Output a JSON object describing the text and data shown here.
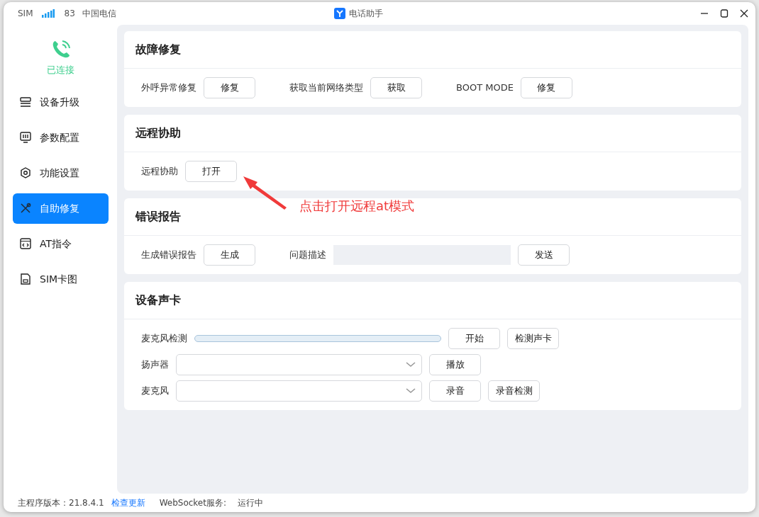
{
  "title_bar": {
    "sim_label": "SIM",
    "signal_value": "83",
    "carrier": "中国电信",
    "app_title": "电话助手"
  },
  "sidebar": {
    "status": "已连接",
    "items": [
      {
        "label": "设备升级",
        "selected": false
      },
      {
        "label": "参数配置",
        "selected": false
      },
      {
        "label": "功能设置",
        "selected": false
      },
      {
        "label": "自助修复",
        "selected": true
      },
      {
        "label": "AT指令",
        "selected": false
      },
      {
        "label": "SIM卡图",
        "selected": false
      }
    ]
  },
  "sections": [
    {
      "title": "故障修复",
      "rows": [
        [
          {
            "kind": "label",
            "text": "外呼异常修复"
          },
          {
            "kind": "button",
            "text": "修复"
          },
          {
            "kind": "label",
            "text": "获取当前网络类型"
          },
          {
            "kind": "button",
            "text": "获取"
          },
          {
            "kind": "label",
            "text": "BOOT MODE"
          },
          {
            "kind": "button",
            "text": "修复"
          }
        ]
      ]
    },
    {
      "title": "远程协助",
      "rows": [
        [
          {
            "kind": "label",
            "text": "远程协助"
          },
          {
            "kind": "button",
            "text": "打开"
          }
        ]
      ]
    },
    {
      "title": "错误报告",
      "rows": [
        [
          {
            "kind": "label",
            "text": "生成错误报告"
          },
          {
            "kind": "button",
            "text": "生成"
          },
          {
            "kind": "label",
            "text": "问题描述"
          },
          {
            "kind": "field"
          },
          {
            "kind": "button",
            "text": "发送"
          }
        ]
      ]
    },
    {
      "title": "设备声卡",
      "rows": [
        [
          {
            "kind": "label",
            "text": "麦克风检测"
          },
          {
            "kind": "progress",
            "level": 0
          },
          {
            "kind": "button",
            "text": "开始"
          },
          {
            "kind": "button",
            "text": "检测声卡"
          }
        ],
        [
          {
            "kind": "label",
            "text": "扬声器"
          },
          {
            "kind": "select"
          },
          {
            "kind": "button",
            "text": "播放"
          }
        ],
        [
          {
            "kind": "label",
            "text": "麦克风"
          },
          {
            "kind": "select"
          },
          {
            "kind": "button",
            "text": "录音"
          },
          {
            "kind": "button",
            "text": "录音检测"
          }
        ]
      ]
    }
  ],
  "annotation": {
    "text": "点击打开远程at模式"
  },
  "status_bar": {
    "version_label": "主程序版本：21.8.4.1",
    "update_link": "检查更新",
    "websocket_label": "WebSocket服务:",
    "websocket_status": "运行中"
  }
}
